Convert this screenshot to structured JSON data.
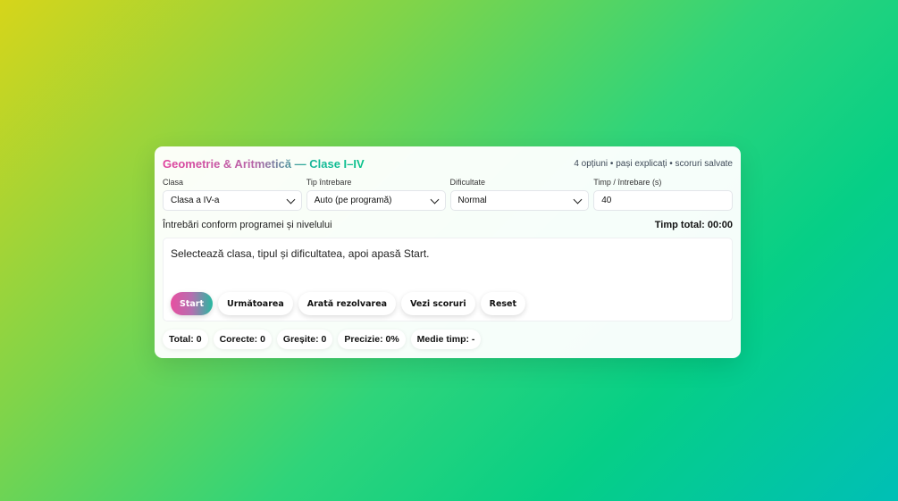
{
  "header": {
    "title": "Geometrie & Aritmetică — Clase I–IV",
    "subtitle": "4 opțiuni • pași explicați • scoruri salvate"
  },
  "fields": {
    "class": {
      "label": "Clasa",
      "value": "Clasa a IV-a"
    },
    "type": {
      "label": "Tip întrebare",
      "value": "Auto (pe programă)"
    },
    "difficulty": {
      "label": "Dificultate",
      "value": "Normal"
    },
    "time": {
      "label": "Timp / întrebare (s)",
      "value": "40"
    }
  },
  "info": {
    "note": "Întrebări conform programei și nivelului",
    "total_time": "Timp total: 00:00"
  },
  "question": {
    "text": "Selectează clasa, tipul și dificultatea, apoi apasă Start."
  },
  "buttons": {
    "start": "Start",
    "next": "Următoarea",
    "solution": "Arată rezolvarea",
    "scores": "Vezi scoruri",
    "reset": "Reset"
  },
  "stats": {
    "total": "Total: 0",
    "correct": "Corecte: 0",
    "wrong": "Greșite: 0",
    "precision": "Precizie: 0%",
    "avg_time": "Medie timp: -"
  },
  "colors": {
    "accent_pink": "#e84fa0",
    "accent_teal": "#08c28a"
  }
}
